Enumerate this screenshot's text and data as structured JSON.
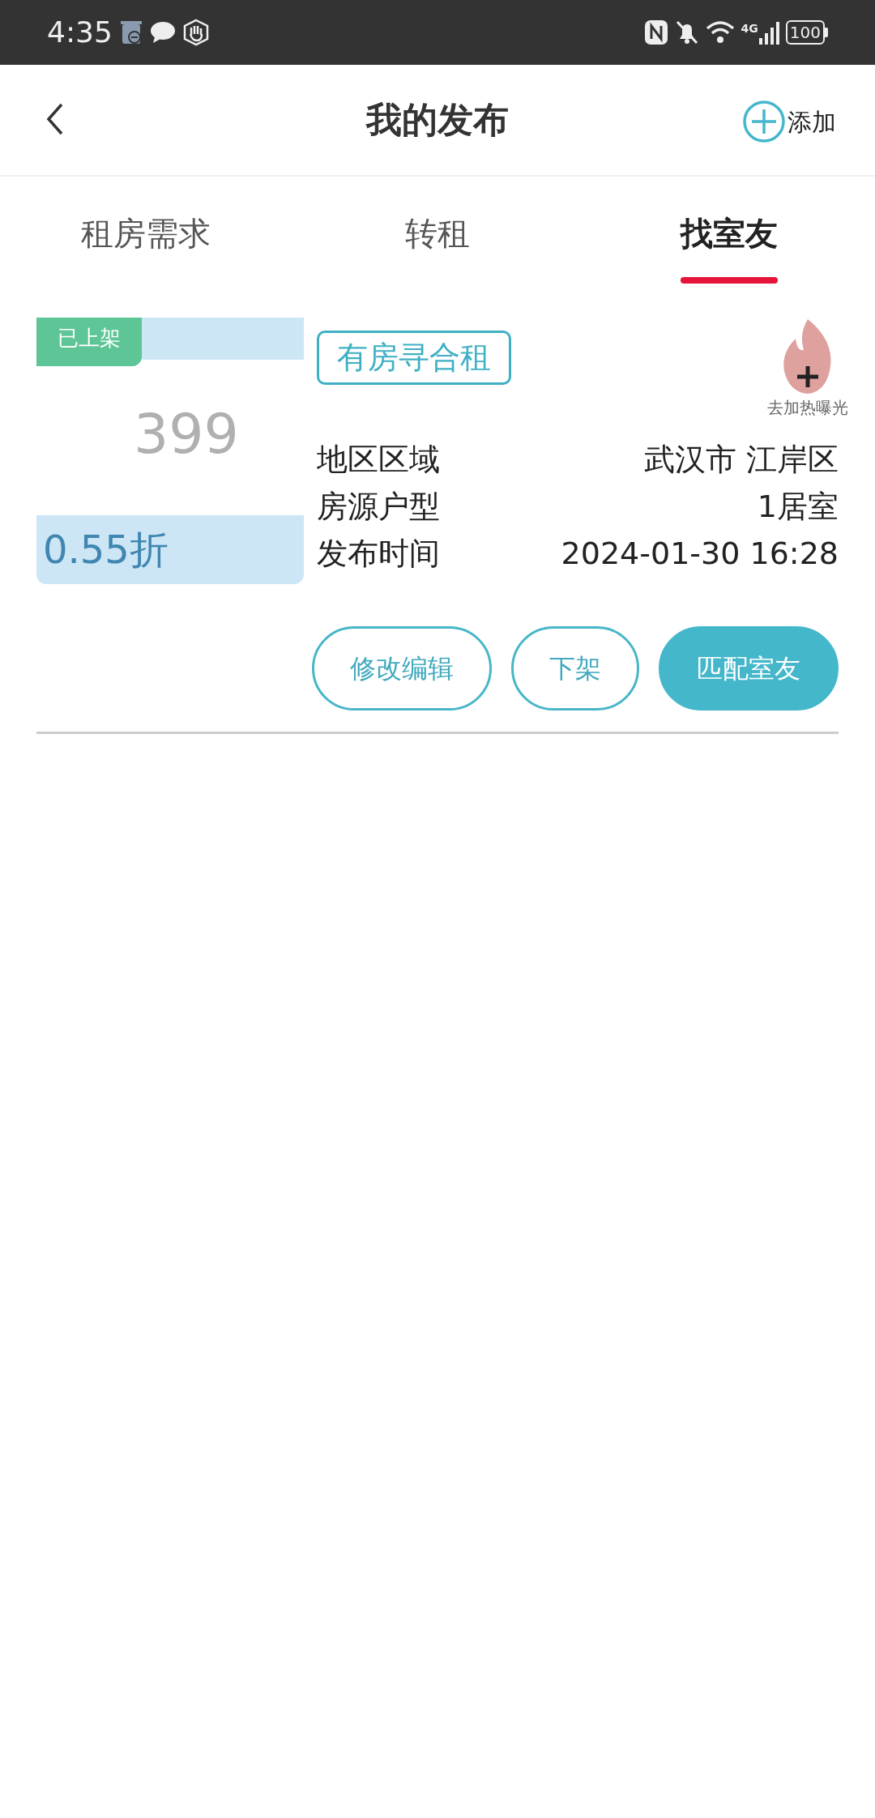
{
  "status_bar": {
    "time": "4:35",
    "network": "4G",
    "battery": "100"
  },
  "header": {
    "title": "我的发布",
    "add_label": "添加"
  },
  "tabs": [
    {
      "label": "租房需求",
      "selected": false
    },
    {
      "label": "转租",
      "selected": false
    },
    {
      "label": "找室友",
      "selected": true
    }
  ],
  "posts": [
    {
      "status": "已上架",
      "price": "399",
      "discount": "0.55折",
      "tag": "有房寻合租",
      "boost": "去加热曝光",
      "fields": [
        {
          "label": "地区区域",
          "value": "武汉市 江岸区"
        },
        {
          "label": "房源户型",
          "value": "1居室"
        },
        {
          "label": "发布时间",
          "value": "2024-01-30 16:28"
        }
      ],
      "actions": [
        {
          "label": "修改编辑",
          "kind": "outline"
        },
        {
          "label": "下架",
          "kind": "outline"
        },
        {
          "label": "匹配室友",
          "kind": "filled"
        }
      ]
    }
  ]
}
